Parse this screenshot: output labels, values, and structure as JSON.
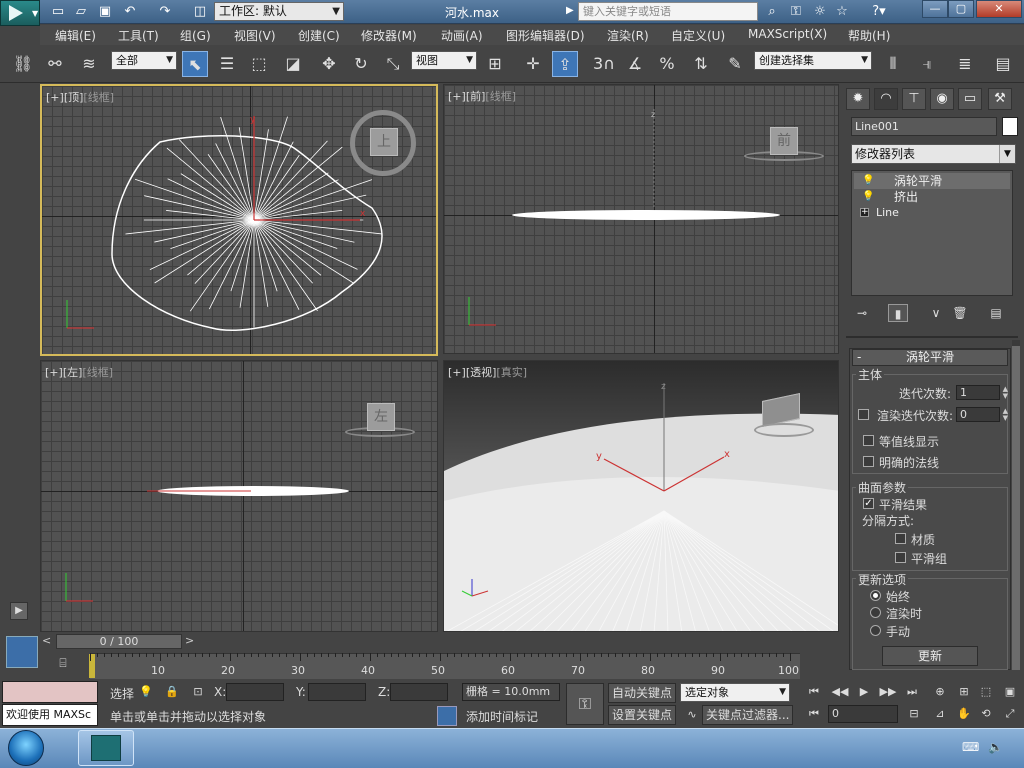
{
  "titlebar": {
    "workspace_label": "工作区: 默认",
    "document_title": "河水.max",
    "search_placeholder": "键入关键字或短语"
  },
  "menubar": {
    "items": [
      "编辑(E)",
      "工具(T)",
      "组(G)",
      "视图(V)",
      "创建(C)",
      "修改器(M)",
      "动画(A)",
      "图形编辑器(D)",
      "渲染(R)",
      "自定义(U)",
      "MAXScript(X)",
      "帮助(H)"
    ]
  },
  "toolbar": {
    "filter_value": "全部",
    "refcoord_value": "视图",
    "snap_angle_label": "3",
    "named_selection_value": "创建选择集"
  },
  "viewports": [
    {
      "id": "top",
      "label_plus": "[+]",
      "label_view": "[顶]",
      "label_mode": "[线框]",
      "cube_label": "上"
    },
    {
      "id": "front",
      "label_plus": "[+]",
      "label_view": "[前]",
      "label_mode": "[线框]",
      "cube_label": "前"
    },
    {
      "id": "left",
      "label_plus": "[+]",
      "label_view": "[左]",
      "label_mode": "[线框]",
      "cube_label": "左"
    },
    {
      "id": "persp",
      "label_plus": "[+]",
      "label_view": "[透视]",
      "label_mode": "[真实]",
      "cube_label": ""
    }
  ],
  "command_panel": {
    "object_name": "Line001",
    "object_color": "#ffffff",
    "modifier_list_label": "修改器列表",
    "stack": [
      {
        "label": "涡轮平滑",
        "selected": true
      },
      {
        "label": "挤出",
        "selected": false
      },
      {
        "label": "Line",
        "selected": false
      }
    ],
    "rollout": {
      "title": "涡轮平滑",
      "main_group": "主体",
      "iterations_label": "迭代次数:",
      "iterations_value": "1",
      "render_iters_label": "渲染迭代次数:",
      "render_iters_value": "0",
      "isoline_label": "等值线显示",
      "explicit_normals_label": "明确的法线",
      "surface_group": "曲面参数",
      "smooth_result_label": "平滑结果",
      "smooth_result_checked": true,
      "separate_label": "分隔方式:",
      "materials_label": "材质",
      "smoothing_groups_label": "平滑组",
      "update_group": "更新选项",
      "always_label": "始终",
      "when_render_label": "渲染时",
      "manually_label": "手动",
      "update_button": "更新",
      "update_selected": "always"
    }
  },
  "timeline": {
    "frame_display": "0 / 100",
    "ticks": [
      "10",
      "20",
      "30",
      "40",
      "50",
      "60",
      "70",
      "80",
      "90",
      "100"
    ]
  },
  "status": {
    "color_box": "#e3c4c4",
    "welcome_label": "欢迎使用 MAXSc",
    "selection_label": "选择",
    "x_label": "X:",
    "y_label": "Y:",
    "z_label": "Z:",
    "grid_label": "栅格 = 10.0mm",
    "prompt_text": "单击或单击并拖动以选择对象",
    "add_time_tag": "添加时间标记",
    "auto_key_label": "自动关键点",
    "set_key_label": "设置关键点",
    "key_mode_value": "选定对象",
    "key_filters_label": "关键点过滤器...",
    "frame_field_value": "0"
  }
}
